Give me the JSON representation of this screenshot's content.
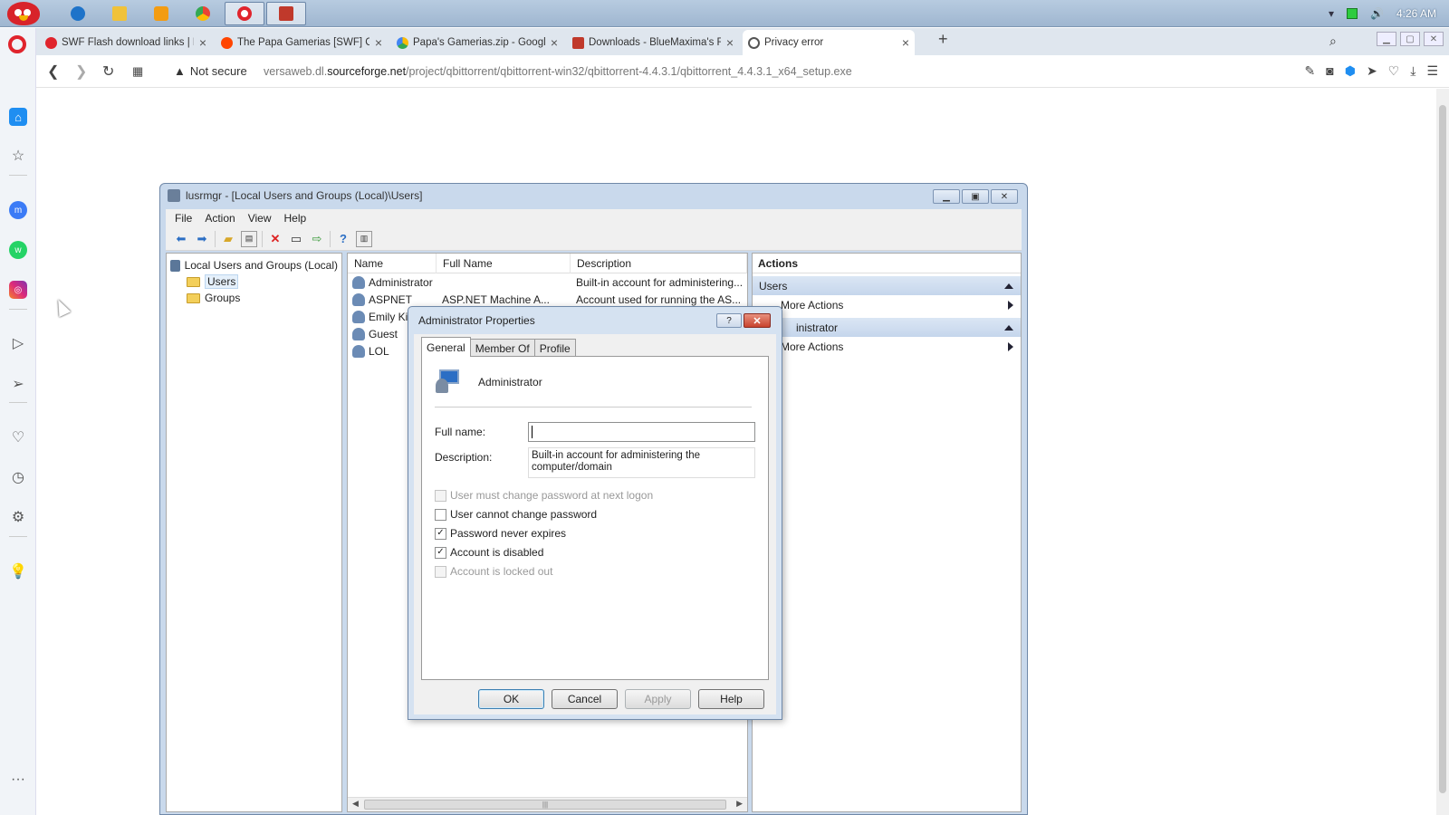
{
  "taskbar": {
    "clock": "4:26 AM"
  },
  "browser": {
    "tabs": [
      {
        "title": "SWF Flash download links | F...",
        "color": "#e0242c"
      },
      {
        "title": "The Papa Gamerias [SWF] Co...",
        "color": "#ff4500"
      },
      {
        "title": "Papa's Gamerias.zip - Google...",
        "color": "#34a853"
      },
      {
        "title": "Downloads - BlueMaxima's Fla...",
        "color": "#c0392b"
      },
      {
        "title": "Privacy error",
        "color": "#555555"
      }
    ],
    "address": {
      "security": "Not secure",
      "url_prefix": "versaweb.dl.",
      "url_domain": "sourceforge.net",
      "url_path": "/project/qbittorrent/qbittorrent-win32/qbittorrent-4.4.3.1/qbittorrent_4.4.3.1_x64_setup.exe"
    }
  },
  "mmc": {
    "title": "lusrmgr - [Local Users and Groups (Local)\\Users]",
    "menu": [
      "File",
      "Action",
      "View",
      "Help"
    ],
    "tree": {
      "root": "Local Users and Groups (Local)",
      "children": [
        "Users",
        "Groups"
      ]
    },
    "columns": [
      "Name",
      "Full Name",
      "Description"
    ],
    "rows": [
      {
        "name": "Administrator",
        "full": "",
        "desc": "Built-in account for administering..."
      },
      {
        "name": "ASPNET",
        "full": "ASP.NET Machine A...",
        "desc": "Account used for running the AS..."
      },
      {
        "name": "Emily Ki",
        "full": "",
        "desc": ""
      },
      {
        "name": "Guest",
        "full": "",
        "desc": ""
      },
      {
        "name": "LOL",
        "full": "",
        "desc": ""
      }
    ],
    "actions": {
      "header": "Actions",
      "section1": "Users",
      "section1_item": "More Actions",
      "section2": "inistrator",
      "section2_item": "More Actions"
    }
  },
  "dialog": {
    "title": "Administrator Properties",
    "help_glyph": "?",
    "close_glyph": "✕",
    "tabs": [
      "General",
      "Member Of",
      "Profile"
    ],
    "user": "Administrator",
    "full_name_label": "Full name:",
    "full_name_value": "",
    "description_label": "Description:",
    "description_value": "Built-in account for administering the computer/domain",
    "checkboxes": [
      {
        "label": "User must change password at next logon",
        "checked": false,
        "disabled": true
      },
      {
        "label": "User cannot change password",
        "checked": false,
        "disabled": false
      },
      {
        "label": "Password never expires",
        "checked": true,
        "disabled": false
      },
      {
        "label": "Account is disabled",
        "checked": true,
        "disabled": false
      },
      {
        "label": "Account is locked out",
        "checked": false,
        "disabled": true
      }
    ],
    "buttons": {
      "ok": "OK",
      "cancel": "Cancel",
      "apply": "Apply",
      "help": "Help"
    }
  }
}
